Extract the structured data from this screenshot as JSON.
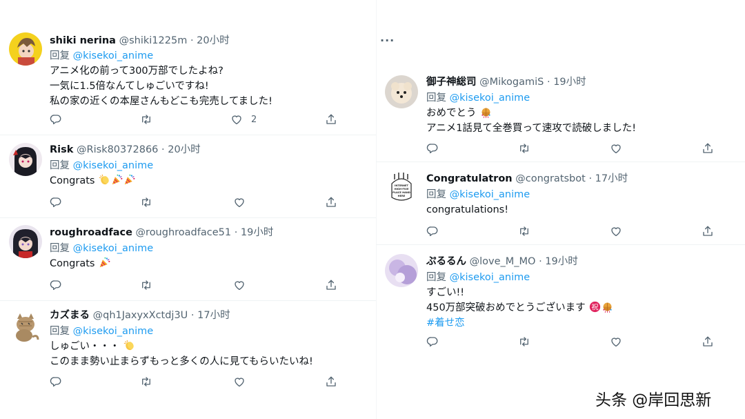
{
  "replies_left": [
    {
      "name": "shiki nerina",
      "handle": "@shiki1225m",
      "time": "20小时",
      "reply_prefix": "回复",
      "reply_to": "@kisekoi_anime",
      "lines": [
        "アニメ化の前って300万部でしたよね?",
        "一気に1.5倍なんてしゅごいですね!",
        "私の家の近くの本屋さんもどこも完売してました!"
      ],
      "like_count": "2"
    },
    {
      "name": "Risk",
      "handle": "@Risk80372866",
      "time": "20小时",
      "reply_prefix": "回复",
      "reply_to": "@kisekoi_anime",
      "lines": [
        "Congrats"
      ],
      "emojis": [
        "clapping-hands-emoji",
        "party-popper-emoji",
        "party-popper-emoji"
      ]
    },
    {
      "name": "roughroadface",
      "handle": "@roughroadface51",
      "time": "19小时",
      "reply_prefix": "回复",
      "reply_to": "@kisekoi_anime",
      "lines": [
        "Congrats"
      ],
      "emojis": [
        "party-popper-emoji"
      ]
    },
    {
      "name": "カズまる",
      "handle": "@qh1JaxyxXctdj3U",
      "time": "17小时",
      "reply_prefix": "回复",
      "reply_to": "@kisekoi_anime",
      "lines": [
        "しゅごい・・・",
        "このまま勢い止まらずもっと多くの人に見てもらいたいね!"
      ],
      "emojis": [
        "clapping-hands-emoji"
      ]
    }
  ],
  "replies_right": [
    {
      "name": "御子神総司",
      "handle": "@MikogamiS",
      "time": "19小时",
      "reply_prefix": "回复",
      "reply_to": "@kisekoi_anime",
      "lines": [
        "おめでとう",
        "アニメ1話見て全巻買って速攻で読破しました!"
      ],
      "emojis": [
        "confetti-ball-emoji"
      ]
    },
    {
      "name": "Congratulatron",
      "handle": "@congratsbot",
      "time": "17小时",
      "reply_prefix": "回复",
      "reply_to": "@kisekoi_anime",
      "lines": [
        "congratulations!"
      ],
      "avatar_text": [
        "INTERNET",
        "HIGH-FIVE",
        "PLACE HAND",
        "HERE"
      ]
    },
    {
      "name": "ぷるるん",
      "handle": "@love_M_MO",
      "time": "19小时",
      "reply_prefix": "回复",
      "reply_to": "@kisekoi_anime",
      "lines": [
        "すごい!!",
        "450万部突破おめでとうございます"
      ],
      "hashtag": "#着せ恋",
      "emojis": [
        "congratulations-ideograph-emoji",
        "confetti-ball-emoji"
      ]
    }
  ],
  "more_menu": "···",
  "watermark": "头条 @岸回思新",
  "icons": [
    "reply-icon",
    "retweet-icon",
    "like-icon",
    "share-icon",
    "more-icon"
  ],
  "colors": {
    "link": "#1d9bf0",
    "secondary": "#536471",
    "text": "#0f1419"
  }
}
